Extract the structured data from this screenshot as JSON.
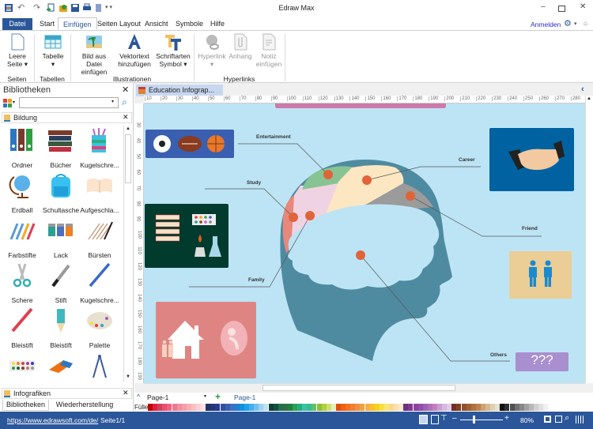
{
  "app": {
    "title": "Edraw Max",
    "signin": "Anmelden"
  },
  "tabs": [
    "Datei",
    "Start",
    "Einfügen",
    "Seiten Layout",
    "Ansicht",
    "Symbole",
    "Hilfe"
  ],
  "ribbon": {
    "buttons": [
      {
        "l1": "Leere",
        "l2": "Seite ▾",
        "icon": "blank-page-icon"
      },
      {
        "l1": "Tabelle",
        "l2": "▾",
        "icon": "table-icon"
      },
      {
        "l1": "Bild aus Datei",
        "l2": "einfügen",
        "icon": "image-icon"
      },
      {
        "l1": "Vektortext",
        "l2": "hinzufügen",
        "icon": "vector-text-icon"
      },
      {
        "l1": "Schriftarten",
        "l2": "Symbol ▾",
        "icon": "font-symbol-icon"
      },
      {
        "l1": "Hyperlink",
        "l2": "▾",
        "icon": "hyperlink-icon"
      },
      {
        "l1": "Anhang",
        "l2": "",
        "icon": "attachment-icon"
      },
      {
        "l1": "Notiz",
        "l2": "einfügen",
        "icon": "note-icon"
      }
    ],
    "groups": [
      "Seiten",
      "Tabellen",
      "Illustrationen",
      "Hyperlinks"
    ]
  },
  "library": {
    "title": "Bibliotheken",
    "search_placeholder": "",
    "category": "Bildung",
    "items": [
      "Ordner",
      "Bücher",
      "Kugelschre...",
      "Erdball",
      "Schultasche",
      "Aufgeschla...",
      "Farbstifte",
      "Lack",
      "Bürsten",
      "Schere",
      "Stift",
      "Kugelschre...",
      "Bleistift",
      "Bleistift",
      "Palette"
    ],
    "bottom_category": "Infografiken",
    "bottom_tabs": [
      "Bibliotheken",
      "Wiederherstellung"
    ]
  },
  "document": {
    "tab": "Education Infograp...",
    "page_select": "Page-1",
    "page_tab": "Page-1",
    "fill_label": "Füller"
  },
  "ruler": {
    "h": [
      10,
      20,
      30,
      40,
      50,
      60,
      70,
      80,
      90,
      100,
      110,
      120,
      130,
      140,
      150,
      160,
      170,
      180,
      190,
      200,
      210,
      220,
      230,
      240,
      250,
      260,
      270,
      280
    ],
    "v": [
      30,
      40,
      50,
      60,
      70,
      80,
      90,
      100,
      110,
      120,
      130,
      140,
      150,
      160,
      170,
      180,
      190
    ]
  },
  "infographic": {
    "labels": {
      "entertainment": "Entertainment",
      "career": "Career",
      "friend": "Friend",
      "study": "Study",
      "family": "Family",
      "others": "Others"
    },
    "others_box": "???"
  },
  "palette": [
    "#c00000",
    "#e0203a",
    "#d0405a",
    "#e85070",
    "#f06080",
    "#f07890",
    "#f090a0",
    "#f4a0a8",
    "#f8b0b0",
    "#f8c0c0",
    "#fad0d0",
    "#fce0e8",
    "#203060",
    "#203878",
    "#283890",
    "#3050a0",
    "#3860b0",
    "#4070c0",
    "#2080d0",
    "#1090e0",
    "#20a0e8",
    "#40b0f0",
    "#70c0f0",
    "#a0d0f0",
    "#c0e0f4",
    "#104030",
    "#105040",
    "#207050",
    "#307040",
    "#208040",
    "#30a050",
    "#20b080",
    "#40c0a0",
    "#30c090",
    "#60c070",
    "#90c030",
    "#b0d040",
    "#d0e070",
    "#e0f0c0",
    "#e05010",
    "#f06010",
    "#f07020",
    "#f08030",
    "#f09040",
    "#f0a040",
    "#f8b040",
    "#f8c030",
    "#f8d020",
    "#f8e040",
    "#f8e870",
    "#f8d890",
    "#f8e0b0",
    "#fce8c8",
    "#703080",
    "#803890",
    "#9040a0",
    "#9050a8",
    "#a060b0",
    "#b070b8",
    "#c080c0",
    "#c8a0d0",
    "#d8b8e0",
    "#e0c8e8",
    "#703020",
    "#804020",
    "#905030",
    "#a06030",
    "#b07040",
    "#c08050",
    "#d0a070",
    "#d8b890",
    "#e0d0b0",
    "#e8e0d0",
    "#101010",
    "#303030",
    "#505050",
    "#707070",
    "#888888",
    "#a0a0a0",
    "#b8b8b8",
    "#d0d0d0",
    "#e0e0e0",
    "#f0f0f0"
  ],
  "status": {
    "url": "https://www.edrawsoft.com/de/",
    "page": "Seite1/1",
    "zoom": "80%",
    "zoom_fraction": 0.3
  }
}
